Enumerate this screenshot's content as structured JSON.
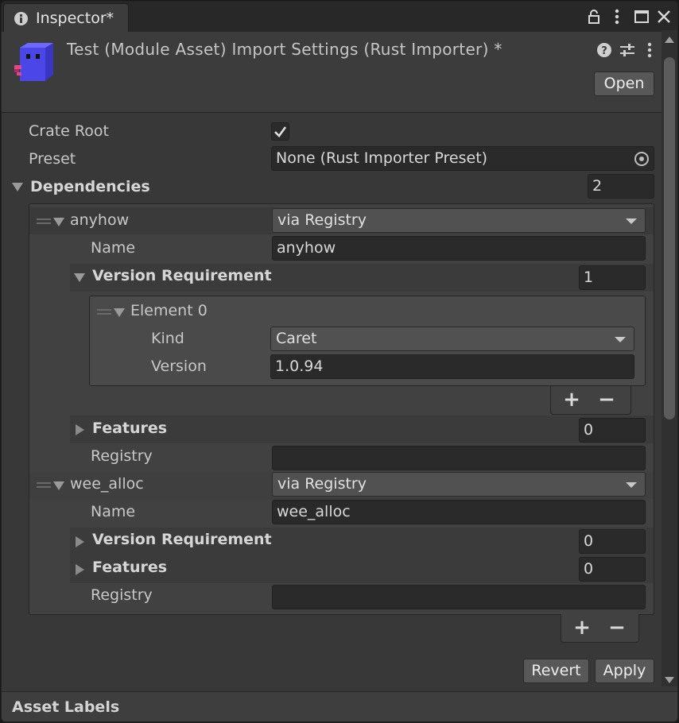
{
  "tab": {
    "title": "Inspector*"
  },
  "header": {
    "title": "Test (Module Asset) Import Settings (Rust Importer) *",
    "open_label": "Open"
  },
  "crate_root": {
    "label": "Crate Root",
    "checked": true
  },
  "preset": {
    "label": "Preset",
    "value": "None (Rust Importer Preset)"
  },
  "dependencies": {
    "label": "Dependencies",
    "count": "2",
    "items": [
      {
        "name_value": "anyhow",
        "source": "via Registry",
        "name_label": "Name",
        "version_requirement": {
          "label": "Version Requirement",
          "count": "1",
          "elements": [
            {
              "label": "Element 0",
              "kind_label": "Kind",
              "kind": "Caret",
              "version_label": "Version",
              "version": "1.0.94"
            }
          ]
        },
        "features": {
          "label": "Features",
          "count": "0"
        },
        "registry": {
          "label": "Registry",
          "value": ""
        }
      },
      {
        "name_value": "wee_alloc",
        "source": "via Registry",
        "name_label": "Name",
        "version_requirement": {
          "label": "Version Requirement",
          "count": "0"
        },
        "features": {
          "label": "Features",
          "count": "0"
        },
        "registry": {
          "label": "Registry",
          "value": ""
        }
      }
    ]
  },
  "list_controls": {
    "add": "+",
    "remove": "−"
  },
  "buttons": {
    "revert": "Revert",
    "apply": "Apply"
  },
  "footer": {
    "title": "Asset Labels"
  },
  "colors": {
    "background": "#383838",
    "field": "#2a2a2a",
    "asset_icon": "#4b46e8"
  },
  "icons": [
    "info-icon",
    "lock-icon",
    "kebab-menu-icon",
    "maximize-icon",
    "close-icon",
    "help-icon",
    "preset-sliders-icon",
    "object-picker-icon"
  ]
}
